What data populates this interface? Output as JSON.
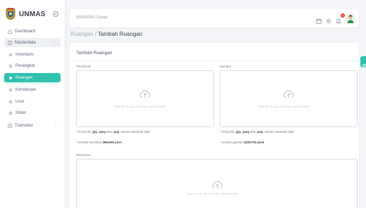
{
  "brand": {
    "name": "UNMAS"
  },
  "sidebar": {
    "items": [
      {
        "label": "Dashboard",
        "icon": "home-icon"
      },
      {
        "label": "Masterdata",
        "icon": "grid-icon"
      },
      {
        "label": "Inventaris"
      },
      {
        "label": "Perangkat"
      },
      {
        "label": "Ruangan"
      },
      {
        "label": "Kendaraan"
      },
      {
        "label": "User"
      },
      {
        "label": "Slider"
      },
      {
        "label": "Transaksi",
        "icon": "file-icon"
      }
    ]
  },
  "navbar": {
    "period": "2024/2025 | Ganjil",
    "notification_count": "2"
  },
  "breadcrumb": {
    "parent": "Ruangan",
    "separator": " / ",
    "current": "Tambah Ruangan"
  },
  "form": {
    "title": "Tambah Ruangan",
    "thumbnail": {
      "label": "Thumbnail",
      "dropzone_text": "Tarik file ke sini atau klik untuk memilih",
      "note_format_1": "* format file ",
      "note_format_2": ".jpg",
      "note_format_3": ", ",
      "note_format_4": ".jpeg",
      "note_format_5": " atau ",
      "note_format_6": ".png",
      "note_format_7": ", ukuran maksimal ",
      "note_format_8": "1MB",
      "note_res_1": "* resolusi thumbnail ",
      "note_res_2": "386x250 pixel"
    },
    "gambar": {
      "label": "Gambar",
      "dropzone_text": "Tarik file ke sini atau klik untuk memilih",
      "note_format_1": "* format file ",
      "note_format_2": ".jpg",
      "note_format_3": ", ",
      "note_format_4": ".jpeg",
      "note_format_5": " atau ",
      "note_format_6": ".png",
      "note_format_7": ", ukuran maksimal ",
      "note_format_8": "1MB",
      "note_res_1": "* resolusi gambar ",
      "note_res_2": "1200x704 pixel"
    },
    "panorama": {
      "label": "Panorama",
      "dropzone_text": "Tarik file ke sini atau klik untuk memilih"
    }
  },
  "colors": {
    "accent": "#2ec2ae",
    "badge": "#ff3e1d"
  }
}
